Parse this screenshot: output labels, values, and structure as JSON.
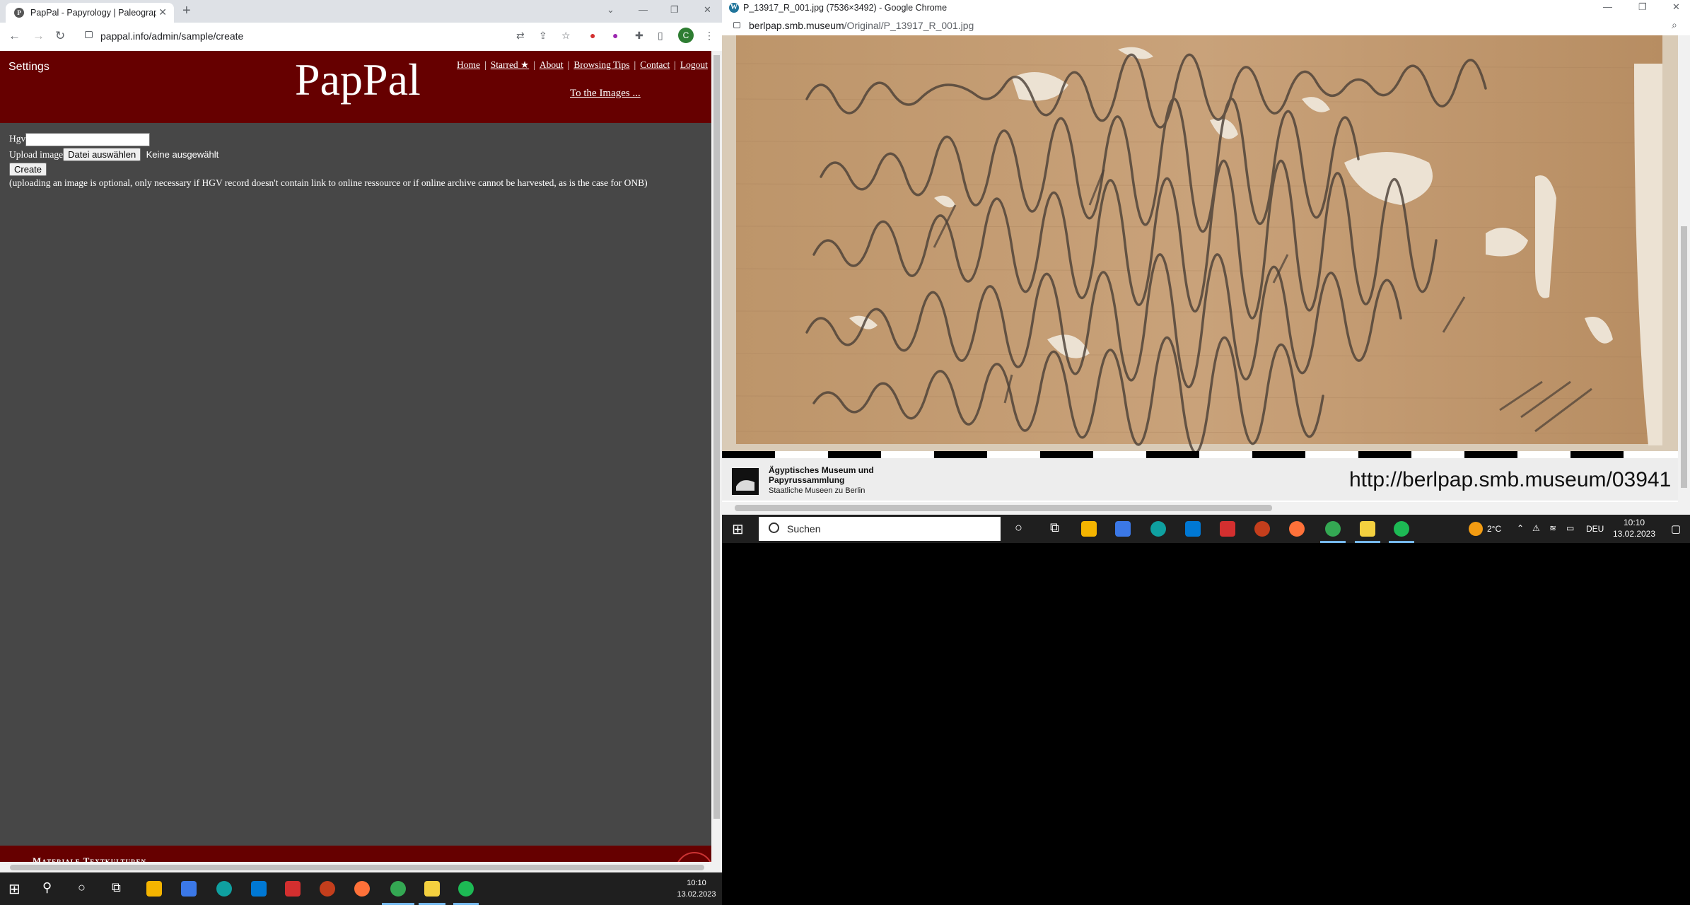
{
  "left_window": {
    "tab_title": "PapPal - Papyrology | Paleography",
    "address": "pappal.info/admin/sample/create",
    "avatar_letter": "C",
    "site": {
      "settings_label": "Settings",
      "logo": "PapPal",
      "nav": [
        "Home",
        "Starred ★",
        "About",
        "Browsing Tips",
        "Contact",
        "Logout"
      ],
      "to_images": "To the Images ...",
      "form": {
        "hgv_label": "Hgv",
        "hgv_value": "",
        "upload_label": "Upload image",
        "file_button": "Datei auswählen",
        "file_status": "Keine ausgewählt",
        "create_button": "Create",
        "note": "(uploading an image is optional, only necessary if HGV record doesn't contain link to online ressource or if online archive cannot be harvested, as is the case for ONB)"
      },
      "footer_text": "Materiale Textkulturen"
    }
  },
  "right_window": {
    "title": "P_13917_R_001.jpg (7536×3492) - Google Chrome",
    "url_host": "berlpap.smb.museum",
    "url_path": "/Original/P_13917_R_001.jpg",
    "museum_name_line1": "Ägyptisches Museum und",
    "museum_name_line2": "Papyrussammlung",
    "museum_sub": "Staatliche Museen zu Berlin",
    "museum_url": "http://berlpap.smb.museum/03941"
  },
  "taskbar_right": {
    "search_placeholder": "Suchen",
    "weather": "2°C",
    "language": "DEU",
    "time": "10:10",
    "date": "13.02.2023"
  },
  "taskbar_left": {
    "time": "10:10",
    "date": "13.02.2023"
  },
  "colors": {
    "site_header": "#660000",
    "page_background": "#474747",
    "taskbar": "#1f1f1f",
    "papyrus": "#c79f74"
  }
}
